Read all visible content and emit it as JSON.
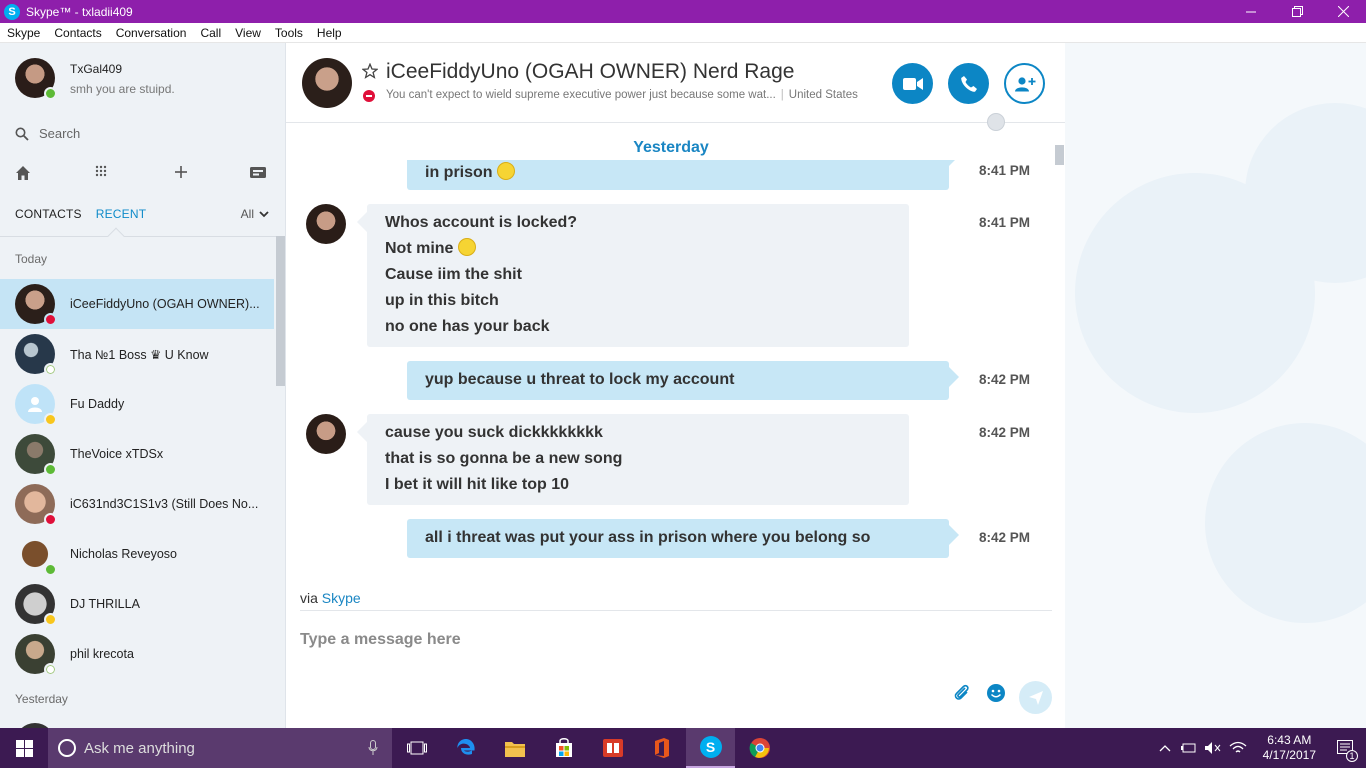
{
  "window": {
    "title": "Skype™ - txladii409",
    "app_icon_letter": "S"
  },
  "menu": [
    "Skype",
    "Contacts",
    "Conversation",
    "Call",
    "View",
    "Tools",
    "Help"
  ],
  "profile": {
    "name": "TxGal409",
    "mood": "smh you are stuipd."
  },
  "search": {
    "placeholder": "Search"
  },
  "tabs": {
    "contacts": "CONTACTS",
    "recent": "RECENT",
    "filter": "All"
  },
  "sections": {
    "today": "Today",
    "yesterday": "Yesterday"
  },
  "contacts": [
    {
      "name": "iCeeFiddyUno (OGAH OWNER)...",
      "status": "dnd"
    },
    {
      "name": "Tha №1 Boss ♛ U Know",
      "status": "offline"
    },
    {
      "name": "Fu Daddy",
      "status": "away"
    },
    {
      "name": "TheVoice xTDSx",
      "status": "online"
    },
    {
      "name": "iC631nd3C1S1v3 (Still Does No...",
      "status": "dnd"
    },
    {
      "name": "Nicholas Reveyoso",
      "status": "online"
    },
    {
      "name": "DJ THRILLA",
      "status": "away"
    },
    {
      "name": "phil krecota",
      "status": "offline"
    }
  ],
  "conversation": {
    "title": "iCeeFiddyUno (OGAH OWNER) Nerd Rage",
    "mood": "You can't expect to wield supreme executive power just because some wat...",
    "location": "United States",
    "day_label": "Yesterday",
    "messages": [
      {
        "dir": "out",
        "lines": [
          "in prison"
        ],
        "time": "8:41 PM",
        "emoji": true
      },
      {
        "dir": "in",
        "lines": [
          "Whos account is locked?",
          "Not mine",
          "Cause iim the shit",
          "up in this bitch",
          "no one has your back"
        ],
        "time": "8:41 PM"
      },
      {
        "dir": "out",
        "lines": [
          "yup because u threat to lock my account"
        ],
        "time": "8:42 PM"
      },
      {
        "dir": "in",
        "lines": [
          "cause you suck dickkkkkkkk",
          "that is so gonna be a new song",
          "I bet it will hit like top 10"
        ],
        "time": "8:42 PM"
      },
      {
        "dir": "out",
        "lines": [
          "all i threat was put your ass in prison where  you belong so"
        ],
        "time": "8:42 PM"
      }
    ],
    "via_prefix": "via",
    "via_link": "Skype",
    "compose_placeholder": "Type a message here"
  },
  "taskbar": {
    "search_placeholder": "Ask me anything",
    "time": "6:43 AM",
    "date": "4/17/2017",
    "notifications": "1"
  },
  "colors": {
    "titlebar": "#8e1fab",
    "accent": "#0c86c5",
    "taskbar": "#3c1a52"
  }
}
